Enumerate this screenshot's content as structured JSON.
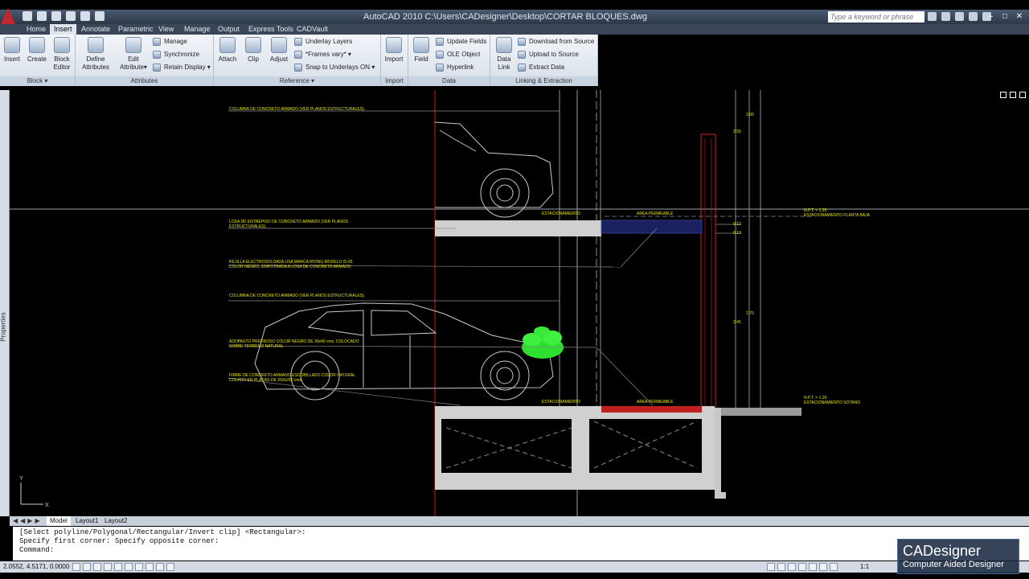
{
  "app": {
    "title": "AutoCAD 2010    C:\\Users\\CADesigner\\Desktop\\CORTAR BLOQUES.dwg",
    "search_placeholder": "Type a keyword or phrase"
  },
  "tabs": [
    "Home",
    "Insert",
    "Annotate",
    "Parametric",
    "View",
    "Manage",
    "Output",
    "Express Tools",
    "CADVault"
  ],
  "active_tab": "Insert",
  "ribbon": {
    "block": {
      "title": "Block",
      "insert": "Insert",
      "create": "Create",
      "block_editor_1": "Block",
      "block_editor_2": "Editor"
    },
    "attributes": {
      "title": "Attributes",
      "define_1": "Define",
      "define_2": "Attributes",
      "edit_1": "Edit",
      "edit_2": "Attribute",
      "manage": "Manage",
      "synchronize": "Synchronize",
      "retain": "Retain Display"
    },
    "reference": {
      "title": "Reference",
      "attach": "Attach",
      "clip": "Clip",
      "adjust": "Adjust",
      "underlay_layers": "Underlay Layers",
      "frames": "*Frames vary*",
      "snap": "Snap to Underlays ON"
    },
    "import": {
      "title": "Import",
      "import": "Import"
    },
    "data": {
      "title": "Data",
      "field": "Field",
      "update_fields": "Update Fields",
      "ole_object": "OLE Object",
      "hyperlink": "Hyperlink"
    },
    "linking": {
      "title": "Linking & Extraction",
      "data_link_1": "Data",
      "data_link_2": "Link",
      "download": "Download from Source",
      "upload": "Upload to Source",
      "extract": "Extract  Data"
    }
  },
  "palette_label": "Properties",
  "drawing": {
    "notes": {
      "n1": "COLUMNA DE CONCRETO ARMADO (VER PLANOS ESTRUCTURALES).",
      "n2a": "LOSA DE ENTREPISO DE CONCRETO ARMADO (VER PLANOS",
      "n2b": "ESTRUCTURALES).",
      "n3a": "REJILLA ELECTROSOLDADA USA MARCA IRVING MODELO IS-05",
      "n3b": "COLOR NEGRO, EMPOTRADA A LOSA DE CONCRETO ARMADO",
      "n4": "COLUMNA DE CONCRETO ARMADO (VER PLANOS ESTRUCTURALES).",
      "n5a": "ADOPASTO PREDROSO COLOR NEGRO DE 30x40 cms. COLOCADO",
      "n5b": "SOBRE TERRENO NATURAL",
      "n6a": "FIRME DE CONCRETO ARMADO ESCOBILLADO COLOR NATURAL",
      "n6b": "COLADO EN PLACAS DE 250x250 cms."
    },
    "labels": {
      "est_upper": "ESTACIONAMIENTO",
      "area_upper": "AREA PERMEABLE",
      "est_lower": "ESTACIONAMIENTO",
      "area_lower": "AREA PERMEABLE",
      "npt_upper_1": "N.P.T. = 1.20",
      "npt_upper_2": "ESTACIONAMIENTO PLANTA BAJA",
      "npt_lower_1": "N.P.T. = 1.20",
      "npt_lower_2": "ESTACIONAMIENTO SOTANO"
    },
    "dims": [
      "3.00",
      "2.55",
      "0.12",
      "0.13",
      "2.70",
      "2.45"
    ]
  },
  "layout_tabs": [
    "Model",
    "Layout1",
    "Layout2"
  ],
  "command": {
    "line1": "[Select polyline/Polygonal/Rectangular/Invert clip] <Rectangular>:",
    "line2": "Specify first corner: Specify opposite corner:",
    "prompt": "Command:"
  },
  "status": {
    "coords": "2.0552, 4.5171, 0.0000",
    "scale": "1:1"
  },
  "watermark": {
    "line1": "CADesigner",
    "line2": "Computer Aided Designer"
  }
}
